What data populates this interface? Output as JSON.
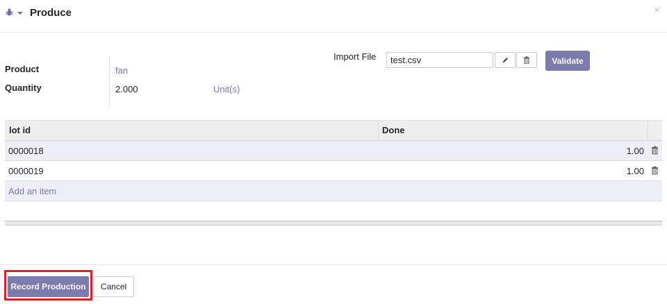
{
  "dialog": {
    "title": "Produce",
    "icons": {
      "menu": "bug-icon",
      "dropdown": "caret-down-icon",
      "close": "close-icon"
    }
  },
  "form": {
    "product_label": "Product",
    "product_value": "fan",
    "quantity_label": "Quantity",
    "quantity_value": "2.000",
    "uom_value": "Unit(s)",
    "import_label": "Import File",
    "import_filename": "test.csv",
    "edit_icon": "pencil-icon",
    "delete_icon": "trash-icon",
    "validate_label": "Validate"
  },
  "table": {
    "columns": [
      "lot id",
      "Done"
    ],
    "rows": [
      {
        "lot": "0000018",
        "done": "1.00"
      },
      {
        "lot": "0000019",
        "done": "1.00"
      }
    ],
    "add_item": "Add an item"
  },
  "footer": {
    "record_label": "Record Production",
    "cancel_label": "Cancel"
  },
  "colors": {
    "accent": "#7c7bad",
    "highlight": "#e0202a"
  }
}
